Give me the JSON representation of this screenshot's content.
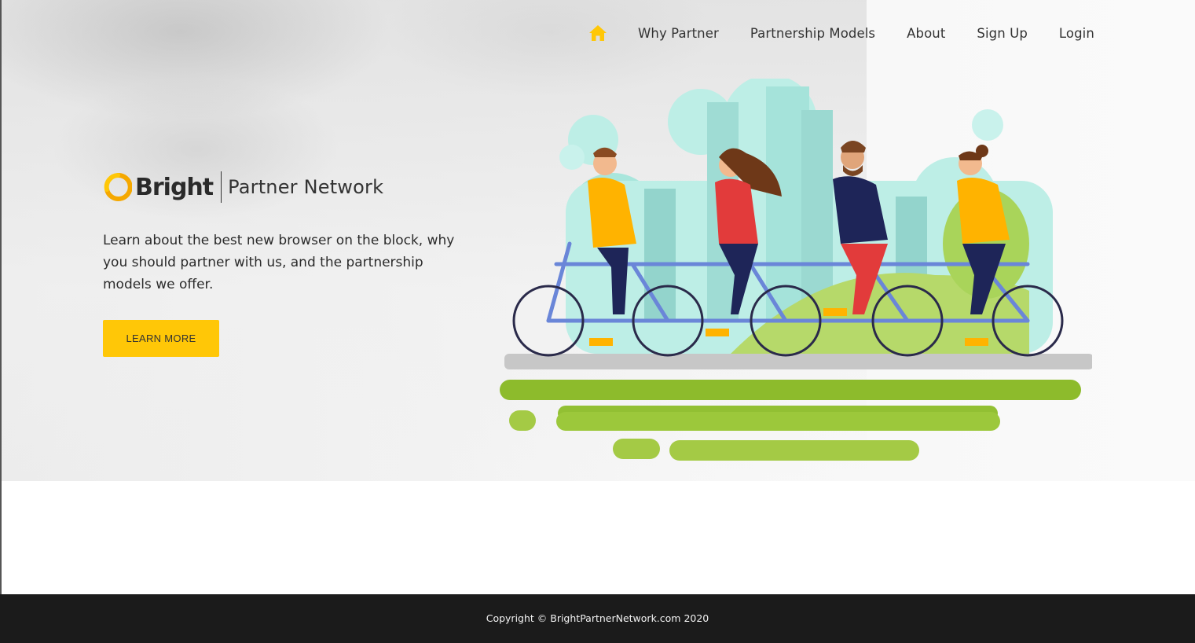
{
  "nav": {
    "home_icon": "home-icon",
    "items": [
      {
        "label": "Why Partner"
      },
      {
        "label": "Partnership Models"
      },
      {
        "label": "About"
      },
      {
        "label": "Sign Up"
      },
      {
        "label": "Login"
      }
    ]
  },
  "brand": {
    "name": "Bright",
    "tagline": "Partner Network",
    "logo_icon": "bright-logo-icon"
  },
  "hero": {
    "text": "Learn about the best new browser on the block, why you should partner with us, and the partnership models we offer.",
    "cta_label": "LEARN MORE",
    "illustration": "people-riding-tandem-bicycle-illustration"
  },
  "footer": {
    "copyright": "Copyright © BrightPartnerNetwork.com 2020"
  },
  "colors": {
    "accent": "#ffc707",
    "footer_bg": "#1b1b1b",
    "grass": "#8dbb2c"
  }
}
